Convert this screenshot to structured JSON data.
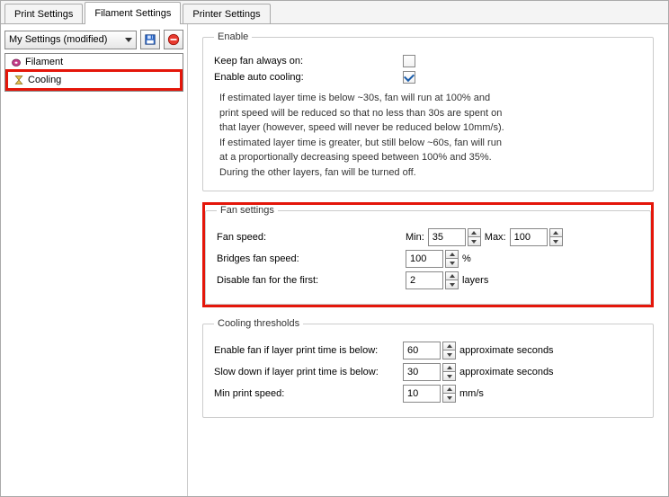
{
  "tabs": {
    "print": "Print Settings",
    "filament": "Filament Settings",
    "printer": "Printer Settings"
  },
  "preset": {
    "label": "My Settings (modified)"
  },
  "sidebar": {
    "items": [
      {
        "label": "Filament"
      },
      {
        "label": "Cooling"
      }
    ]
  },
  "enable": {
    "legend": "Enable",
    "keep_label": "Keep fan always on:",
    "auto_label": "Enable auto cooling:",
    "info_l1": "If estimated layer time is below ~30s, fan will run at 100% and",
    "info_l2": "print speed will be reduced so that no less than 30s are spent on",
    "info_l3": "that layer (however, speed will never be reduced below 10mm/s).",
    "info_l4": "If estimated layer time is greater, but still below ~60s, fan will run",
    "info_l5": "at a proportionally decreasing speed between 100% and 35%.",
    "info_l6": "During the other layers, fan will be turned off."
  },
  "fan": {
    "legend": "Fan settings",
    "speed_label": "Fan speed:",
    "min_label": "Min:",
    "min_value": "35",
    "max_label": "Max:",
    "max_value": "100",
    "bridges_label": "Bridges fan speed:",
    "bridges_value": "100",
    "bridges_unit": "%",
    "disable_label": "Disable fan for the first:",
    "disable_value": "2",
    "disable_unit": "layers"
  },
  "thresh": {
    "legend": "Cooling thresholds",
    "enable_label": "Enable fan if layer print time is below:",
    "enable_value": "60",
    "enable_unit": "approximate seconds",
    "slow_label": "Slow down if layer print time is below:",
    "slow_value": "30",
    "slow_unit": "approximate seconds",
    "minspeed_label": "Min print speed:",
    "minspeed_value": "10",
    "minspeed_unit": "mm/s"
  }
}
